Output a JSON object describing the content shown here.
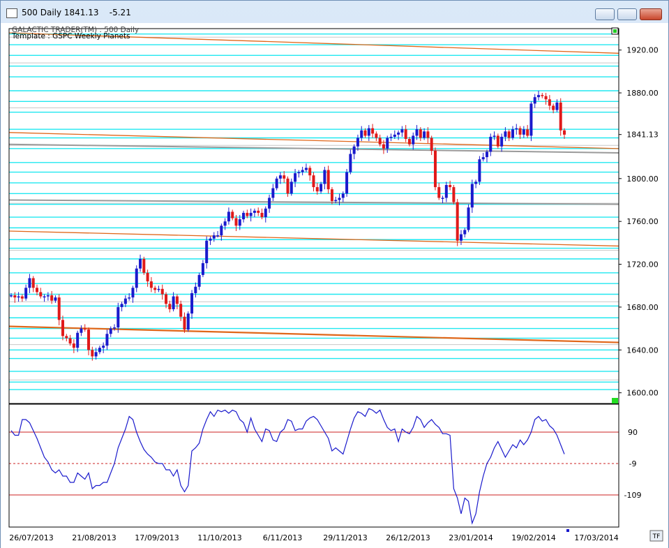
{
  "window": {
    "title": "500 Daily 1841.13    -5.21",
    "minimize_label": "_",
    "maximize_label": "▢",
    "close_label": "✕"
  },
  "header": {
    "line1": "GALACTIC TRADER(TM)  : 500 Daily",
    "line2": "Template : GSPC Weekly Planets"
  },
  "corner_label": "TF",
  "chart_data": [
    {
      "type": "candlestick",
      "ylim": [
        1590,
        1940
      ],
      "y_ticks": [
        "1920.00",
        "1880.00",
        "1841.13",
        "1800.00",
        "1760.00",
        "1720.00",
        "1680.00",
        "1640.00",
        "1600.00"
      ],
      "last_price": "1841.13",
      "x_labels": [
        "26/07/2013",
        "21/08/2013",
        "17/09/2013",
        "11/10/2013",
        "6/11/2013",
        "29/11/2013",
        "26/12/2013",
        "23/01/2014",
        "19/02/2014",
        "17/03/2014"
      ],
      "closes": [
        1691,
        1689,
        1690,
        1688,
        1698,
        1707,
        1698,
        1694,
        1690,
        1690,
        1691,
        1686,
        1689,
        1668,
        1653,
        1651,
        1646,
        1642,
        1656,
        1660,
        1659,
        1640,
        1634,
        1638,
        1642,
        1644,
        1655,
        1660,
        1661,
        1680,
        1683,
        1688,
        1689,
        1698,
        1716,
        1725,
        1712,
        1704,
        1698,
        1696,
        1697,
        1692,
        1683,
        1678,
        1690,
        1683,
        1671,
        1659,
        1674,
        1693,
        1699,
        1710,
        1721,
        1742,
        1744,
        1747,
        1747,
        1756,
        1760,
        1769,
        1763,
        1756,
        1762,
        1768,
        1765,
        1768,
        1770,
        1768,
        1764,
        1772,
        1782,
        1791,
        1800,
        1803,
        1800,
        1786,
        1797,
        1805,
        1806,
        1808,
        1810,
        1803,
        1792,
        1788,
        1795,
        1808,
        1790,
        1779,
        1780,
        1782,
        1786,
        1806,
        1823,
        1830,
        1838,
        1845,
        1840,
        1847,
        1842,
        1838,
        1832,
        1828,
        1838,
        1839,
        1841,
        1843,
        1846,
        1837,
        1832,
        1840,
        1846,
        1838,
        1844,
        1838,
        1826,
        1792,
        1782,
        1782,
        1794,
        1792,
        1778,
        1742,
        1748,
        1752,
        1773,
        1795,
        1797,
        1818,
        1820,
        1825,
        1839,
        1840,
        1830,
        1839,
        1844,
        1838,
        1846,
        1847,
        1841,
        1846,
        1840,
        1870,
        1876,
        1878,
        1877,
        1874,
        1868,
        1864,
        1871,
        1845,
        1841
      ],
      "horizontal_levels_cyan": [
        1935,
        1925,
        1915,
        1905,
        1895,
        1882,
        1872,
        1862,
        1846,
        1838,
        1828,
        1815,
        1806,
        1796,
        1786,
        1776,
        1764,
        1754,
        1743,
        1735,
        1725,
        1712,
        1702,
        1692,
        1681,
        1670,
        1660,
        1651,
        1640,
        1632,
        1620,
        1610,
        1603
      ],
      "horizontal_levels_gray": [
        1932,
        1908,
        1866,
        1831,
        1777,
        1733,
        1685,
        1645,
        1612
      ],
      "orange_curves": [
        [
          1936,
          1917
        ],
        [
          1843,
          1828
        ],
        [
          1751,
          1737
        ],
        [
          1662,
          1647
        ]
      ],
      "gray_curves": [
        [
          1832,
          1824
        ],
        [
          1780,
          1776
        ]
      ],
      "markers": {
        "top_right_green": true,
        "bottom_right_green": true
      }
    },
    {
      "type": "line",
      "ylim": [
        -190,
        190
      ],
      "y_ticks": [
        "90",
        "-9",
        "-109"
      ],
      "levels": [
        100,
        0,
        -100
      ],
      "values": [
        105,
        90,
        90,
        140,
        140,
        130,
        105,
        80,
        50,
        20,
        5,
        -20,
        -30,
        -20,
        -40,
        -40,
        -60,
        -60,
        -30,
        -40,
        -50,
        -30,
        -80,
        -70,
        -70,
        -60,
        -60,
        -30,
        0,
        50,
        80,
        110,
        150,
        140,
        100,
        70,
        45,
        30,
        20,
        5,
        0,
        0,
        -20,
        -20,
        -40,
        -20,
        -70,
        -90,
        -70,
        40,
        50,
        65,
        110,
        140,
        165,
        150,
        170,
        165,
        170,
        160,
        170,
        165,
        140,
        130,
        100,
        145,
        110,
        90,
        70,
        110,
        105,
        75,
        70,
        100,
        110,
        140,
        135,
        105,
        110,
        110,
        135,
        145,
        150,
        140,
        120,
        100,
        80,
        40,
        50,
        40,
        30,
        70,
        110,
        145,
        165,
        160,
        150,
        175,
        170,
        160,
        170,
        140,
        115,
        105,
        110,
        70,
        110,
        100,
        95,
        115,
        150,
        140,
        115,
        130,
        140,
        125,
        115,
        95,
        95,
        90,
        -80,
        -110,
        -160,
        -110,
        -120,
        -190,
        -160,
        -90,
        -40,
        0,
        20,
        50,
        70,
        45,
        20,
        40,
        60,
        50,
        75,
        60,
        75,
        100,
        140,
        150,
        135,
        140,
        120,
        110,
        90,
        60,
        30
      ]
    }
  ]
}
